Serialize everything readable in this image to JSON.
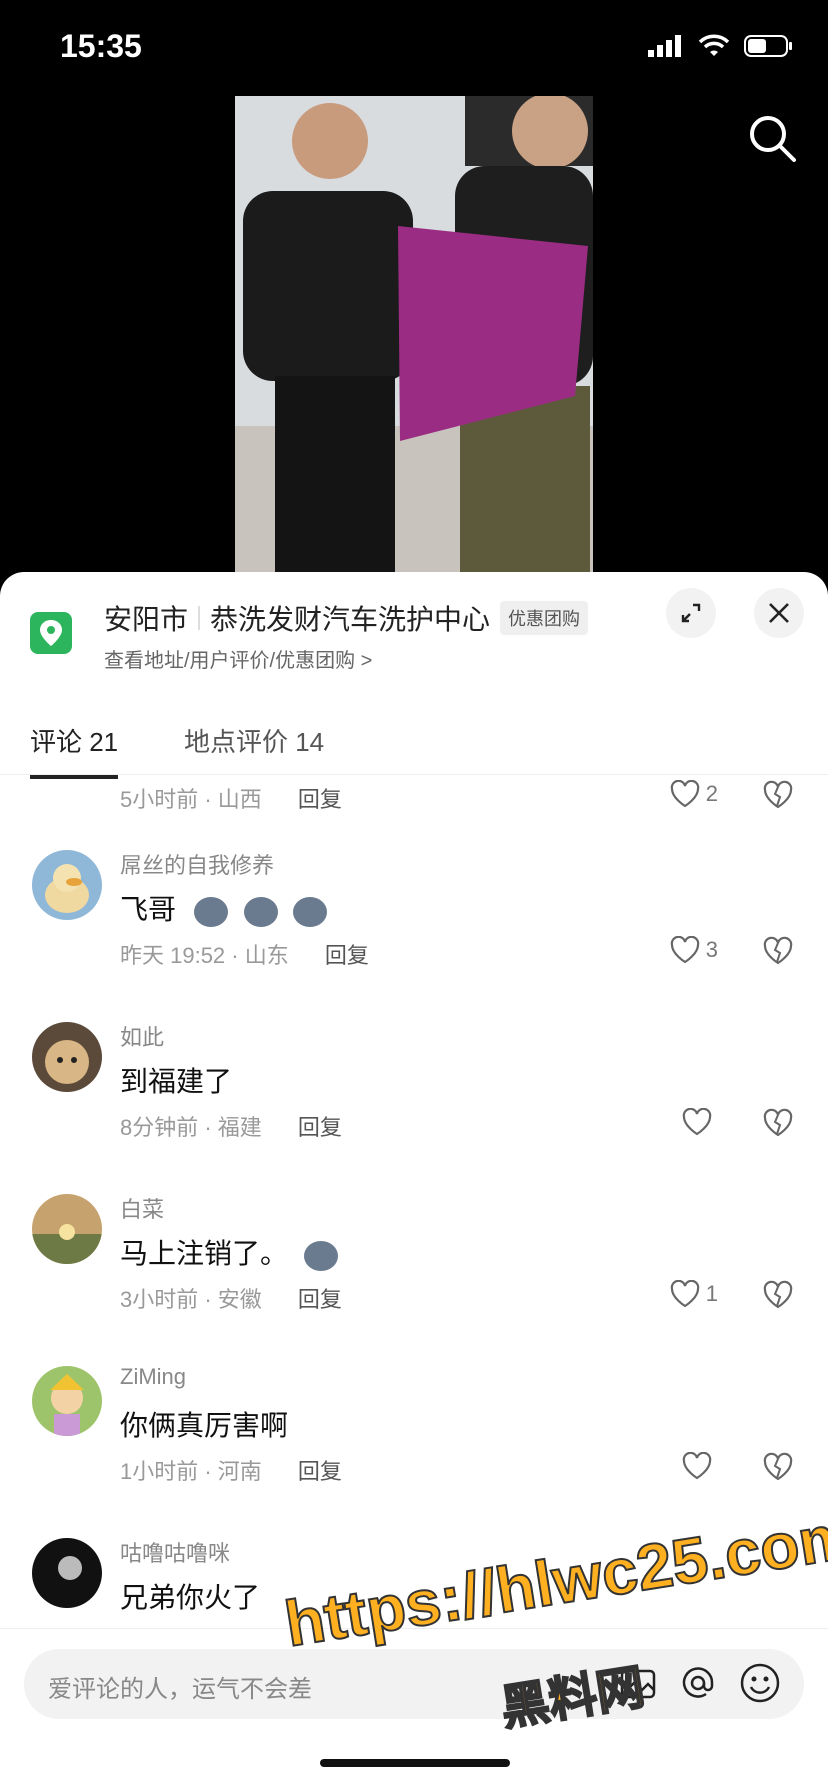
{
  "status": {
    "time": "15:35"
  },
  "location": {
    "city": "安阳市",
    "name": "恭洗发财汽车洗护中心",
    "tag": "优惠团购",
    "subtitle": "查看地址/用户评价/优惠团购 >"
  },
  "tabs": [
    {
      "label": "评论 21"
    },
    {
      "label": "地点评价 14"
    }
  ],
  "comments": [
    {
      "meta": "5小时前 · 山西",
      "reply": "回复",
      "likes": "2"
    },
    {
      "name": "屌丝的自我修养",
      "text": "飞哥",
      "meta": "昨天 19:52 · 山东",
      "reply": "回复",
      "likes": "3"
    },
    {
      "name": "如此",
      "text": "到福建了",
      "meta": "8分钟前 · 福建",
      "reply": "回复",
      "likes": ""
    },
    {
      "name": "白菜",
      "text": "马上注销了。",
      "meta": "3小时前 · 安徽",
      "reply": "回复",
      "likes": "1"
    },
    {
      "name": "ZiMing",
      "text": "你俩真厉害啊",
      "meta": "1小时前 · 河南",
      "reply": "回复",
      "likes": ""
    },
    {
      "name": "咕噜咕噜咪",
      "text": "兄弟你火了"
    }
  ],
  "input": {
    "placeholder": "爱评论的人，运气不会差"
  },
  "watermark": {
    "url": "https://hlwc25.com",
    "cn": "黑料网"
  }
}
